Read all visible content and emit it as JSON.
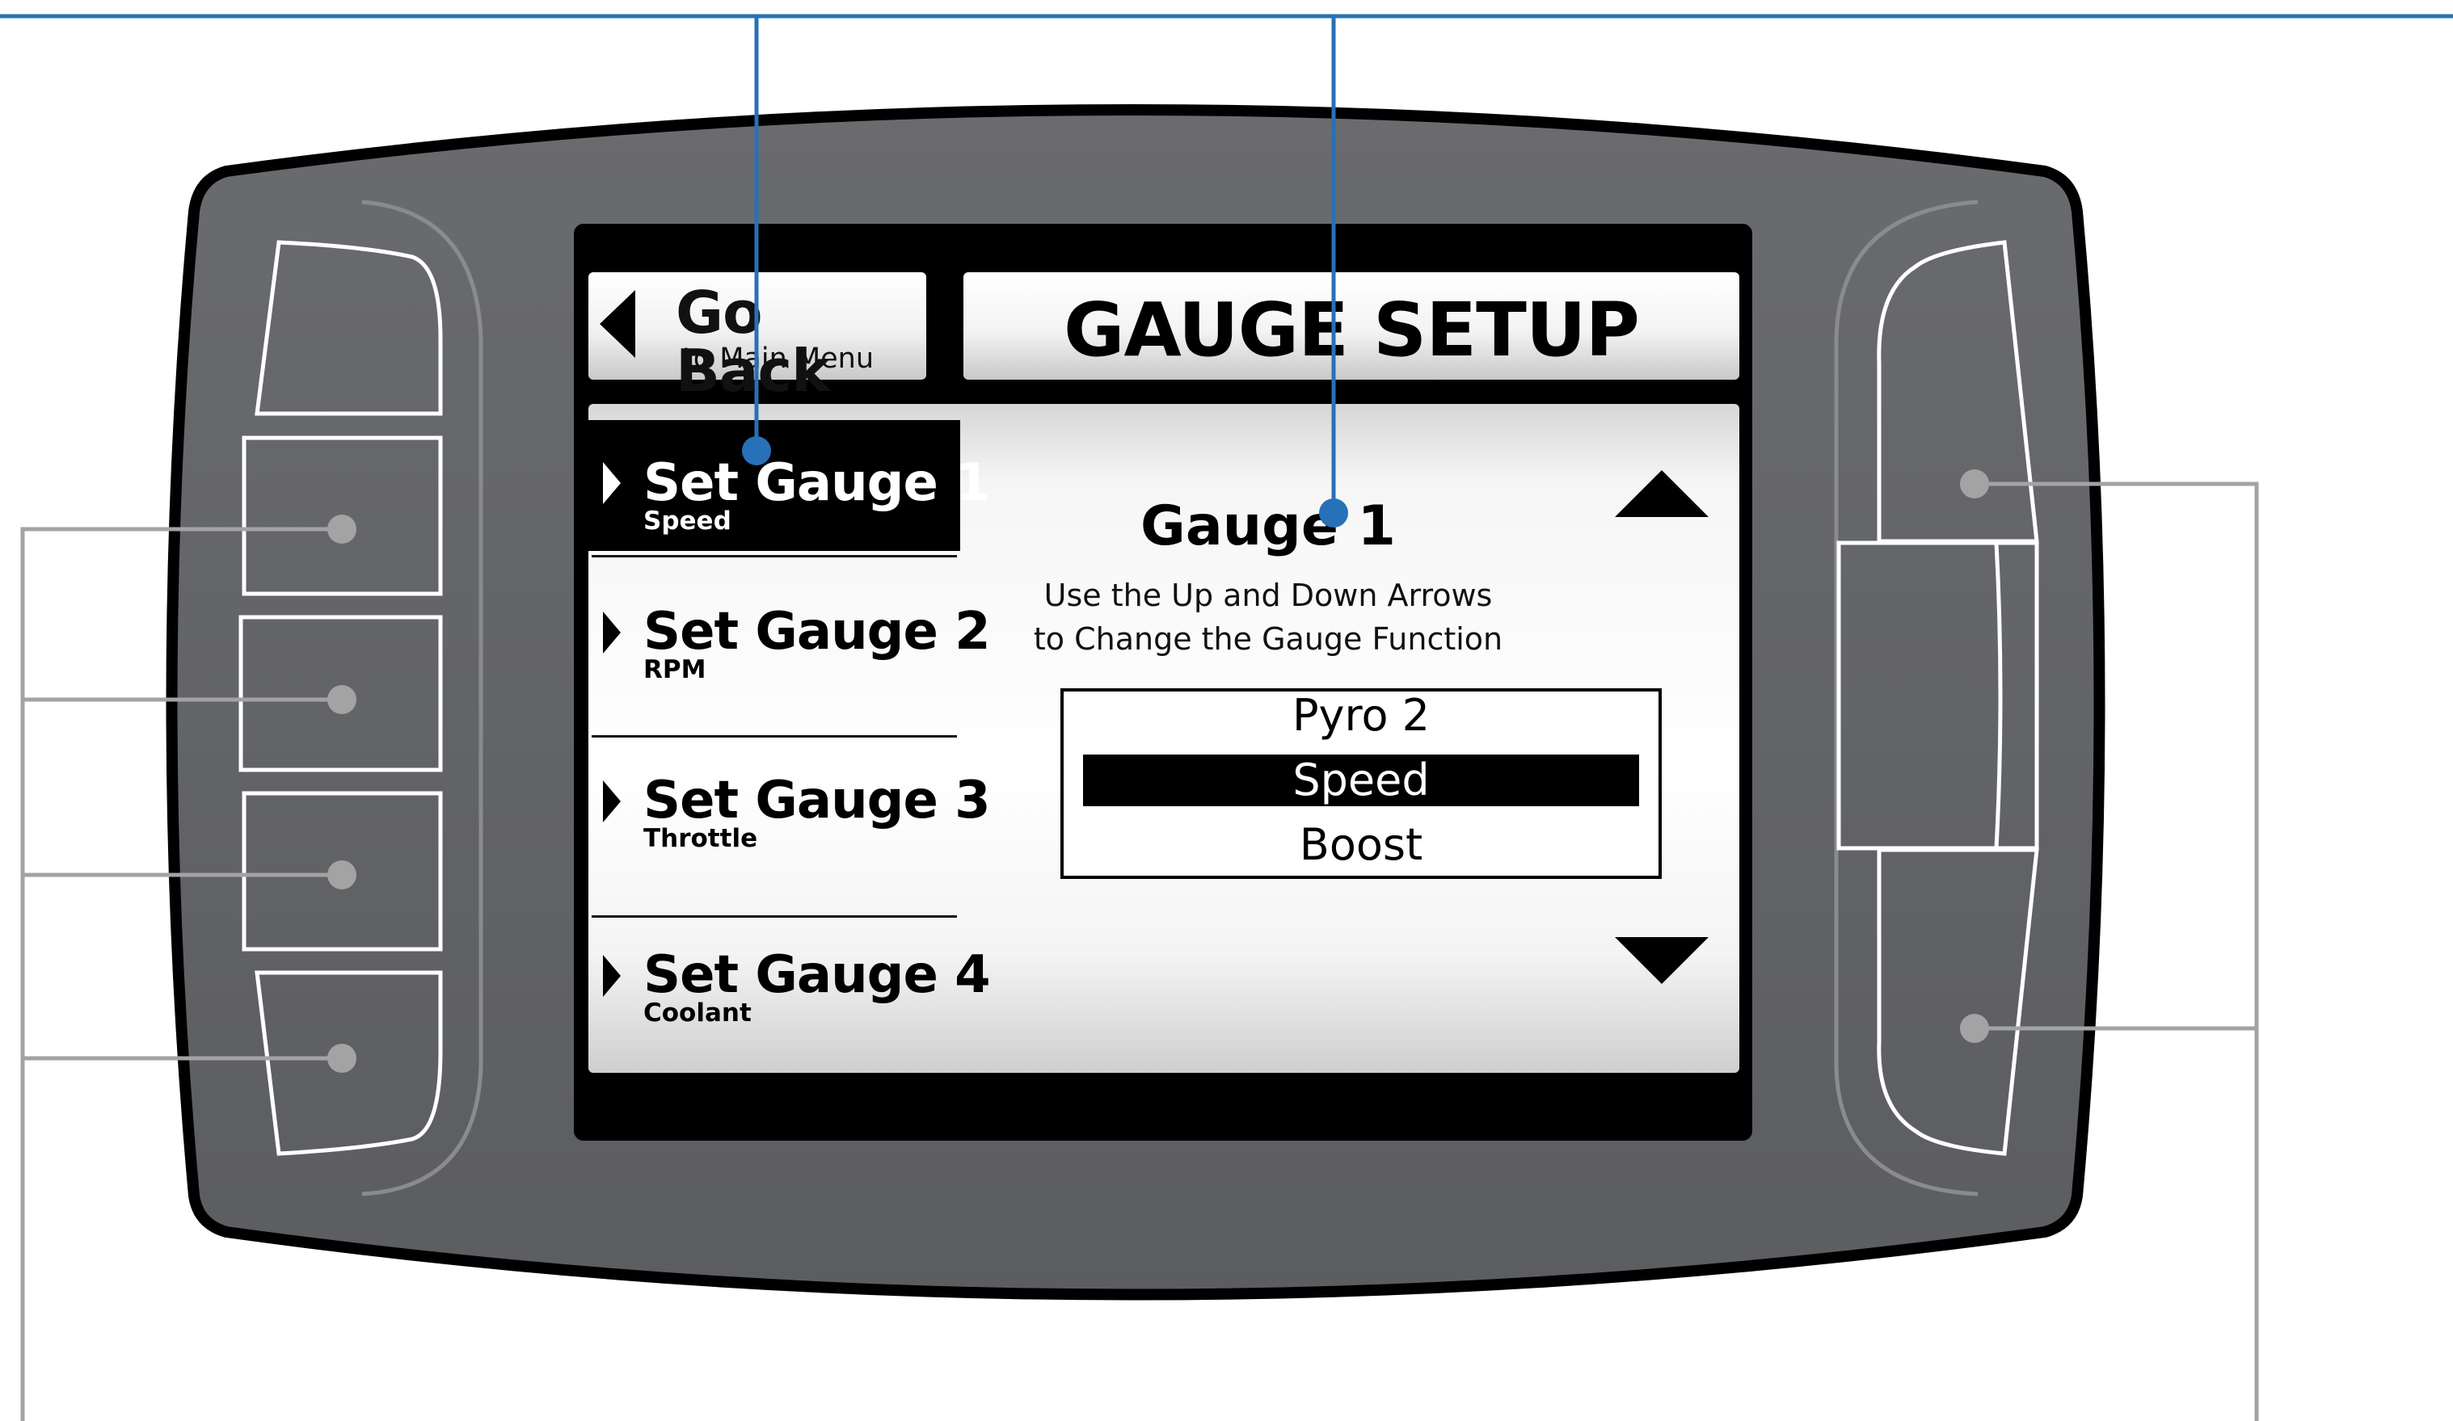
{
  "header": {
    "go_back_label": "Go Back",
    "go_back_sublabel": "to Main Menu",
    "title": "GAUGE SETUP"
  },
  "menu": {
    "items": [
      {
        "label": "Set Gauge 1",
        "sublabel": "Speed",
        "selected": true
      },
      {
        "label": "Set Gauge 2",
        "sublabel": "RPM",
        "selected": false
      },
      {
        "label": "Set Gauge 3",
        "sublabel": "Throttle",
        "selected": false
      },
      {
        "label": "Set Gauge 4",
        "sublabel": "Coolant",
        "selected": false
      }
    ]
  },
  "detail": {
    "heading": "Gauge 1",
    "instruction_line1": "Use the Up and Down Arrows",
    "instruction_line2": "to Change the Gauge Function",
    "options": [
      "Pyro 2",
      "Speed",
      "Boost"
    ],
    "selected_option": "Speed",
    "up_arrow_icon": "triangle-up-icon",
    "down_arrow_icon": "triangle-down-icon"
  },
  "colors": {
    "callout_blue": "#2771b8",
    "callout_gray": "#a3a3a3",
    "bezel": "#636468",
    "screen_frame": "#000000"
  }
}
